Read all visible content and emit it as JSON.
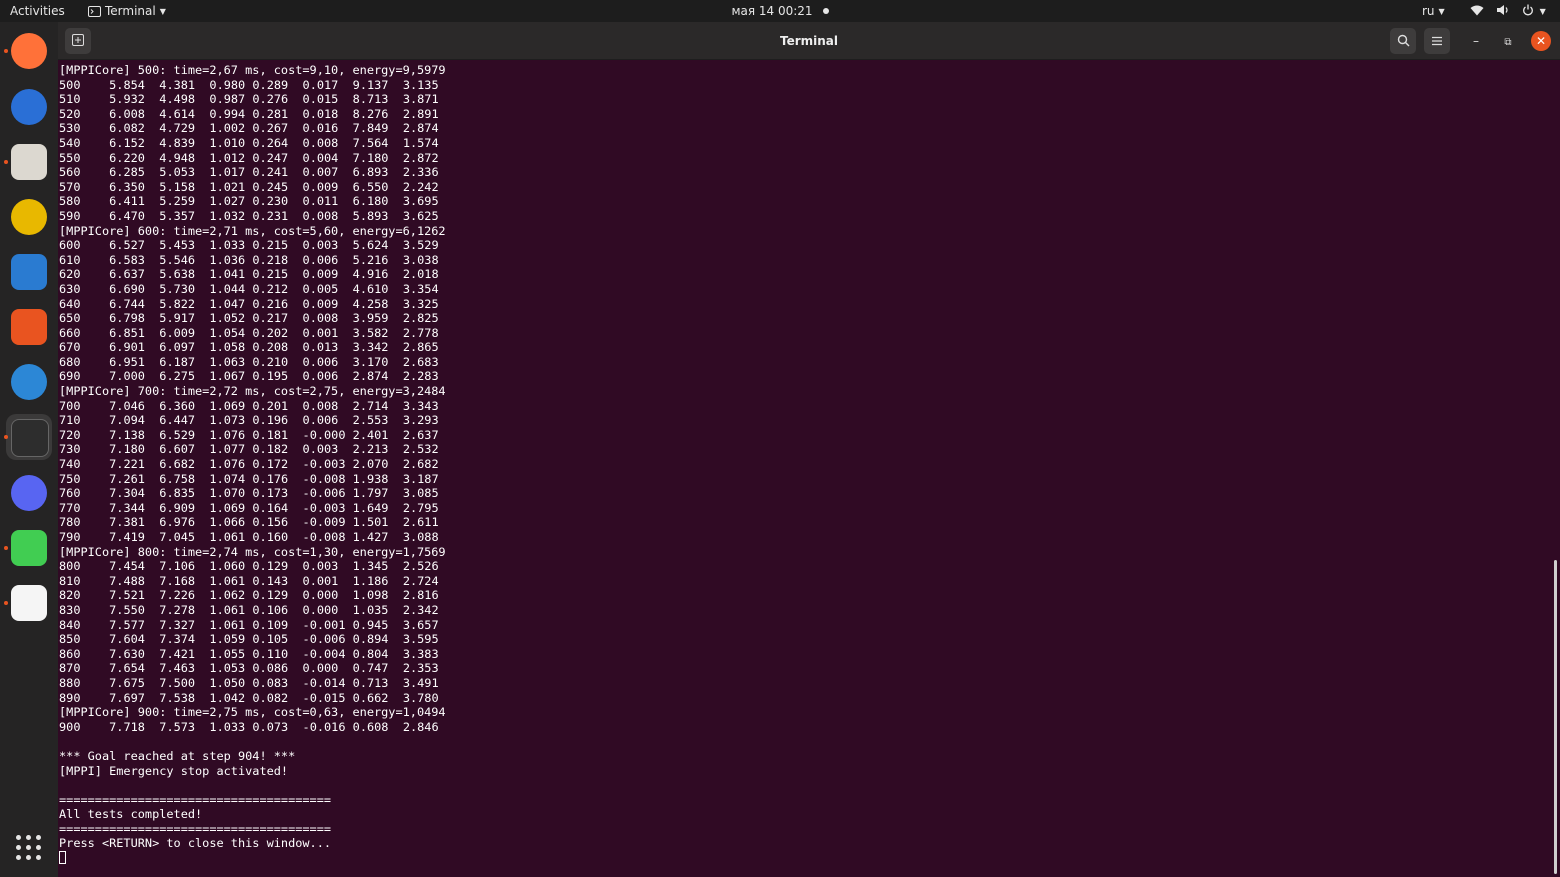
{
  "topbar": {
    "activities": "Activities",
    "app_menu": "Terminal",
    "clock": "мая 14  00:21",
    "language": "ru"
  },
  "dock": {
    "items": [
      {
        "name": "firefox",
        "color": "#ff7139",
        "running": true
      },
      {
        "name": "thunderbird",
        "color": "#2a6fd6",
        "running": false
      },
      {
        "name": "files",
        "color": "#dcd8d0",
        "running": true
      },
      {
        "name": "rhythmbox",
        "color": "#e8b800",
        "running": false
      },
      {
        "name": "libreoffice-writer",
        "color": "#2a7bd1",
        "running": false
      },
      {
        "name": "app-center",
        "color": "#e95420",
        "running": false
      },
      {
        "name": "help",
        "color": "#2c87d6",
        "running": false
      },
      {
        "name": "terminal",
        "color": "#2d2d2d",
        "running": true,
        "active": true
      },
      {
        "name": "discord",
        "color": "#5865f2",
        "running": false
      },
      {
        "name": "qt-creator",
        "color": "#41cd52",
        "running": true
      },
      {
        "name": "text-editor",
        "color": "#f5f5f5",
        "running": true
      }
    ]
  },
  "window": {
    "title": "Terminal"
  },
  "terminal": {
    "lines": [
      "[MPPICore] 500: time=2,67 ms, cost=9,10, energy=9,5979",
      [
        "500",
        "5.854",
        "4.381",
        "0.980",
        "0.289",
        "0.017",
        "9.137",
        "3.135"
      ],
      [
        "510",
        "5.932",
        "4.498",
        "0.987",
        "0.276",
        "0.015",
        "8.713",
        "3.871"
      ],
      [
        "520",
        "6.008",
        "4.614",
        "0.994",
        "0.281",
        "0.018",
        "8.276",
        "2.891"
      ],
      [
        "530",
        "6.082",
        "4.729",
        "1.002",
        "0.267",
        "0.016",
        "7.849",
        "2.874"
      ],
      [
        "540",
        "6.152",
        "4.839",
        "1.010",
        "0.264",
        "0.008",
        "7.564",
        "1.574"
      ],
      [
        "550",
        "6.220",
        "4.948",
        "1.012",
        "0.247",
        "0.004",
        "7.180",
        "2.872"
      ],
      [
        "560",
        "6.285",
        "5.053",
        "1.017",
        "0.241",
        "0.007",
        "6.893",
        "2.336"
      ],
      [
        "570",
        "6.350",
        "5.158",
        "1.021",
        "0.245",
        "0.009",
        "6.550",
        "2.242"
      ],
      [
        "580",
        "6.411",
        "5.259",
        "1.027",
        "0.230",
        "0.011",
        "6.180",
        "3.695"
      ],
      [
        "590",
        "6.470",
        "5.357",
        "1.032",
        "0.231",
        "0.008",
        "5.893",
        "3.625"
      ],
      "[MPPICore] 600: time=2,71 ms, cost=5,60, energy=6,1262",
      [
        "600",
        "6.527",
        "5.453",
        "1.033",
        "0.215",
        "0.003",
        "5.624",
        "3.529"
      ],
      [
        "610",
        "6.583",
        "5.546",
        "1.036",
        "0.218",
        "0.006",
        "5.216",
        "3.038"
      ],
      [
        "620",
        "6.637",
        "5.638",
        "1.041",
        "0.215",
        "0.009",
        "4.916",
        "2.018"
      ],
      [
        "630",
        "6.690",
        "5.730",
        "1.044",
        "0.212",
        "0.005",
        "4.610",
        "3.354"
      ],
      [
        "640",
        "6.744",
        "5.822",
        "1.047",
        "0.216",
        "0.009",
        "4.258",
        "3.325"
      ],
      [
        "650",
        "6.798",
        "5.917",
        "1.052",
        "0.217",
        "0.008",
        "3.959",
        "2.825"
      ],
      [
        "660",
        "6.851",
        "6.009",
        "1.054",
        "0.202",
        "0.001",
        "3.582",
        "2.778"
      ],
      [
        "670",
        "6.901",
        "6.097",
        "1.058",
        "0.208",
        "0.013",
        "3.342",
        "2.865"
      ],
      [
        "680",
        "6.951",
        "6.187",
        "1.063",
        "0.210",
        "0.006",
        "3.170",
        "2.683"
      ],
      [
        "690",
        "7.000",
        "6.275",
        "1.067",
        "0.195",
        "0.006",
        "2.874",
        "2.283"
      ],
      "[MPPICore] 700: time=2,72 ms, cost=2,75, energy=3,2484",
      [
        "700",
        "7.046",
        "6.360",
        "1.069",
        "0.201",
        "0.008",
        "2.714",
        "3.343"
      ],
      [
        "710",
        "7.094",
        "6.447",
        "1.073",
        "0.196",
        "0.006",
        "2.553",
        "3.293"
      ],
      [
        "720",
        "7.138",
        "6.529",
        "1.076",
        "0.181",
        "-0.000",
        "2.401",
        "2.637"
      ],
      [
        "730",
        "7.180",
        "6.607",
        "1.077",
        "0.182",
        "0.003",
        "2.213",
        "2.532"
      ],
      [
        "740",
        "7.221",
        "6.682",
        "1.076",
        "0.172",
        "-0.003",
        "2.070",
        "2.682"
      ],
      [
        "750",
        "7.261",
        "6.758",
        "1.074",
        "0.176",
        "-0.008",
        "1.938",
        "3.187"
      ],
      [
        "760",
        "7.304",
        "6.835",
        "1.070",
        "0.173",
        "-0.006",
        "1.797",
        "3.085"
      ],
      [
        "770",
        "7.344",
        "6.909",
        "1.069",
        "0.164",
        "-0.003",
        "1.649",
        "2.795"
      ],
      [
        "780",
        "7.381",
        "6.976",
        "1.066",
        "0.156",
        "-0.009",
        "1.501",
        "2.611"
      ],
      [
        "790",
        "7.419",
        "7.045",
        "1.061",
        "0.160",
        "-0.008",
        "1.427",
        "3.088"
      ],
      "[MPPICore] 800: time=2,74 ms, cost=1,30, energy=1,7569",
      [
        "800",
        "7.454",
        "7.106",
        "1.060",
        "0.129",
        "0.003",
        "1.345",
        "2.526"
      ],
      [
        "810",
        "7.488",
        "7.168",
        "1.061",
        "0.143",
        "0.001",
        "1.186",
        "2.724"
      ],
      [
        "820",
        "7.521",
        "7.226",
        "1.062",
        "0.129",
        "0.000",
        "1.098",
        "2.816"
      ],
      [
        "830",
        "7.550",
        "7.278",
        "1.061",
        "0.106",
        "0.000",
        "1.035",
        "2.342"
      ],
      [
        "840",
        "7.577",
        "7.327",
        "1.061",
        "0.109",
        "-0.001",
        "0.945",
        "3.657"
      ],
      [
        "850",
        "7.604",
        "7.374",
        "1.059",
        "0.105",
        "-0.006",
        "0.894",
        "3.595"
      ],
      [
        "860",
        "7.630",
        "7.421",
        "1.055",
        "0.110",
        "-0.004",
        "0.804",
        "3.383"
      ],
      [
        "870",
        "7.654",
        "7.463",
        "1.053",
        "0.086",
        "0.000",
        "0.747",
        "2.353"
      ],
      [
        "880",
        "7.675",
        "7.500",
        "1.050",
        "0.083",
        "-0.014",
        "0.713",
        "3.491"
      ],
      [
        "890",
        "7.697",
        "7.538",
        "1.042",
        "0.082",
        "-0.015",
        "0.662",
        "3.780"
      ],
      "[MPPICore] 900: time=2,75 ms, cost=0,63, energy=1,0494",
      [
        "900",
        "7.718",
        "7.573",
        "1.033",
        "0.073",
        "-0.016",
        "0.608",
        "2.846"
      ],
      "",
      "*** Goal reached at step 904! ***",
      "[MPPI] Emergency stop activated!",
      "",
      "======================================",
      "All tests completed!",
      "======================================",
      "Press <RETURN> to close this window..."
    ]
  }
}
